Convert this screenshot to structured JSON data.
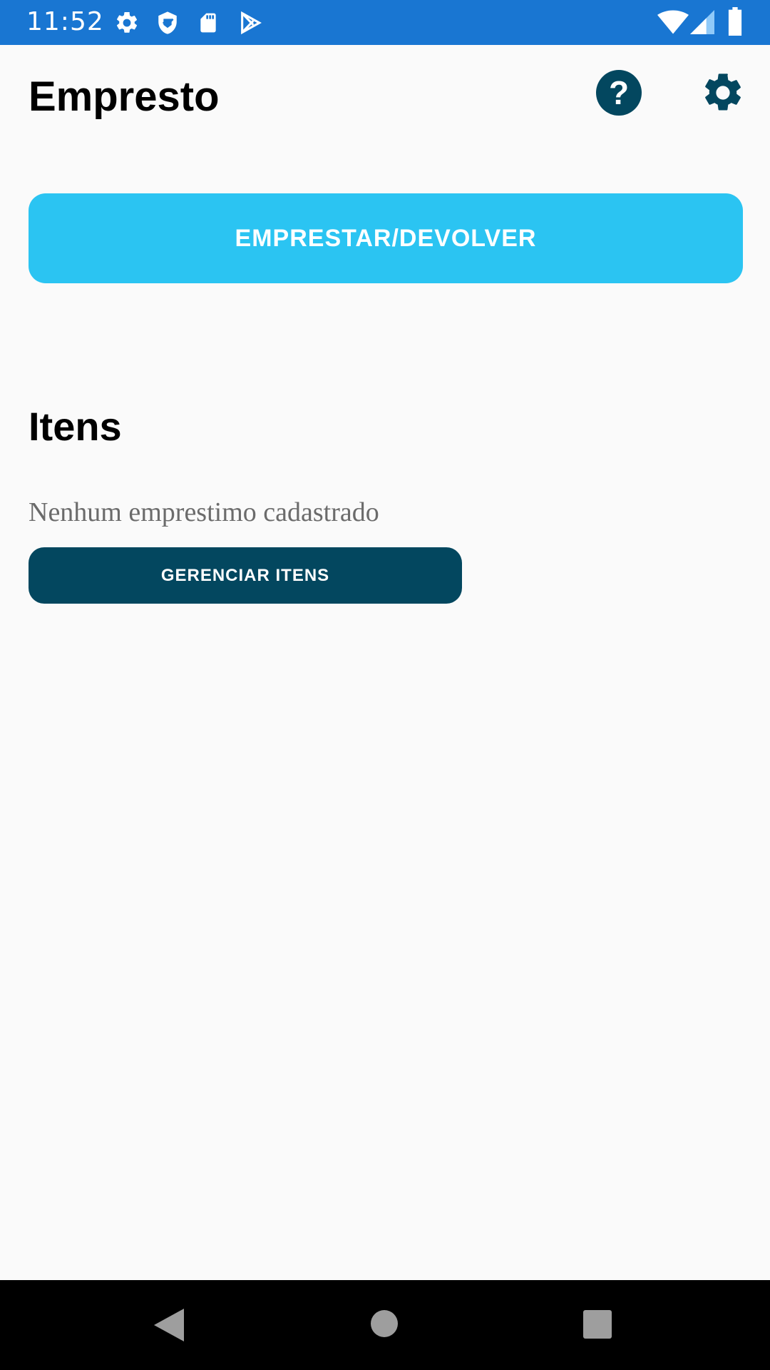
{
  "status_bar": {
    "time": "11:52",
    "left_icons": [
      "gear-icon",
      "shield-icon",
      "sd-card-icon",
      "play-store-icon"
    ],
    "right_icons": [
      "wifi-icon",
      "signal-icon",
      "battery-icon"
    ]
  },
  "header": {
    "title": "Empresto",
    "help_icon": "question-mark",
    "help_label": "?",
    "settings_icon": "gear"
  },
  "main": {
    "primary_button_label": "EMPRESTAR/DEVOLVER",
    "section_title": "Itens",
    "empty_message": "Nenhum emprestimo cadastrado",
    "manage_button_label": "GERENCIAR ITENS"
  },
  "nav_bar": {
    "buttons": [
      "back",
      "home",
      "recents"
    ]
  },
  "colors": {
    "status_bar": "#1976d2",
    "background": "#fafafa",
    "primary_button": "#2bc4f2",
    "dark_accent": "#03475f",
    "nav_bar": "#000000"
  }
}
